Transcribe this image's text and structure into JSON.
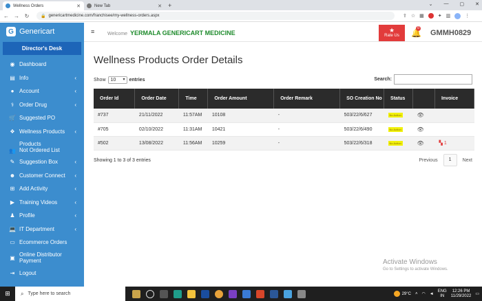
{
  "browser": {
    "tabs": [
      {
        "title": "Wellness Orders",
        "active": true
      },
      {
        "title": "New Tab",
        "active": false
      }
    ],
    "url": "genericartmedicine.com/franchisee/my-wellness-orders.aspx",
    "new_tab_label": "+"
  },
  "sidebar": {
    "brand": "Genericart",
    "brand_initial": "G",
    "desk_label": "Director's Desk",
    "items": [
      {
        "label": "Dashboard",
        "icon": "dashboard-icon",
        "chevron": false
      },
      {
        "label": "Info",
        "icon": "info-icon",
        "chevron": true
      },
      {
        "label": "Account",
        "icon": "account-icon",
        "chevron": true
      },
      {
        "label": "Order Drug",
        "icon": "order-drug-icon",
        "chevron": true
      },
      {
        "label": "Suggested PO",
        "icon": "cart-icon",
        "chevron": false
      },
      {
        "label": "Wellness Products",
        "icon": "wellness-icon",
        "chevron": true
      },
      {
        "label": "Products Not Ordered List",
        "line1": "Products",
        "line2": "Not Ordered List",
        "icon": "users-icon",
        "chevron": false
      },
      {
        "label": "Suggestion Box",
        "icon": "edit-icon",
        "chevron": true
      },
      {
        "label": "Customer Connect",
        "icon": "customer-icon",
        "chevron": true
      },
      {
        "label": "Add Activity",
        "icon": "activity-icon",
        "chevron": true
      },
      {
        "label": "Training Videos",
        "icon": "video-icon",
        "chevron": true
      },
      {
        "label": "Profile",
        "icon": "user-icon",
        "chevron": true
      },
      {
        "label": "IT Department",
        "icon": "laptop-icon",
        "chevron": true
      },
      {
        "label": "Ecommerce Orders",
        "icon": "monitor-icon",
        "chevron": false
      },
      {
        "label": "Online Distributor Payment",
        "line1": "Online Distributor",
        "line2": "Payment",
        "icon": "payment-icon",
        "chevron": false
      },
      {
        "label": "Logout",
        "icon": "logout-icon",
        "chevron": false
      }
    ]
  },
  "header": {
    "welcome": "Welcome",
    "store_name": "YERMALA GENERICART MEDICINE",
    "rate_us": "Rate Us",
    "notification_count": "0",
    "user_code": "GMMH0829"
  },
  "main": {
    "title": "Wellness Products Order Details",
    "show_label": "Show",
    "entries_value": "10",
    "entries_label": "entries",
    "search_label": "Search:",
    "columns": [
      "Order Id",
      "Order Date",
      "Time",
      "Order Amount",
      "Order Remark",
      "SO Creation No",
      "Status",
      "",
      "Invoice"
    ],
    "rows": [
      {
        "order_id": "#737",
        "date": "21/11/2022",
        "time": "11:57AM",
        "amount": "10108",
        "remark": "-",
        "so_no": "503/22/6/627",
        "status": "No Action",
        "invoice": ""
      },
      {
        "order_id": "#705",
        "date": "02/10/2022",
        "time": "11:31AM",
        "amount": "10421",
        "remark": "-",
        "so_no": "503/22/6/490",
        "status": "No Action",
        "invoice": ""
      },
      {
        "order_id": "#502",
        "date": "13/08/2022",
        "time": "11:56AM",
        "amount": "10259",
        "remark": "-",
        "so_no": "503/22/6/318",
        "status": "No Action",
        "invoice": "1"
      }
    ],
    "showing_text": "Showing 1 to 3 of 3 entries",
    "pager": {
      "previous": "Previous",
      "current": "1",
      "next": "Next"
    }
  },
  "watermark": {
    "line1": "Activate Windows",
    "line2": "Go to Settings to activate Windows."
  },
  "taskbar": {
    "search_placeholder": "Type here to search",
    "temperature": "29°C",
    "lang_line1": "ENG",
    "lang_line2": "IN",
    "time": "12:26 PM",
    "date": "11/29/2022"
  },
  "colors": {
    "sidebar": "#3c8dce",
    "desk": "#1d65b8",
    "table_header": "#2b2b2b",
    "store_name": "#1d8a2b",
    "status_badge": "#f1f10c",
    "rate_us": "#e23b3b"
  }
}
